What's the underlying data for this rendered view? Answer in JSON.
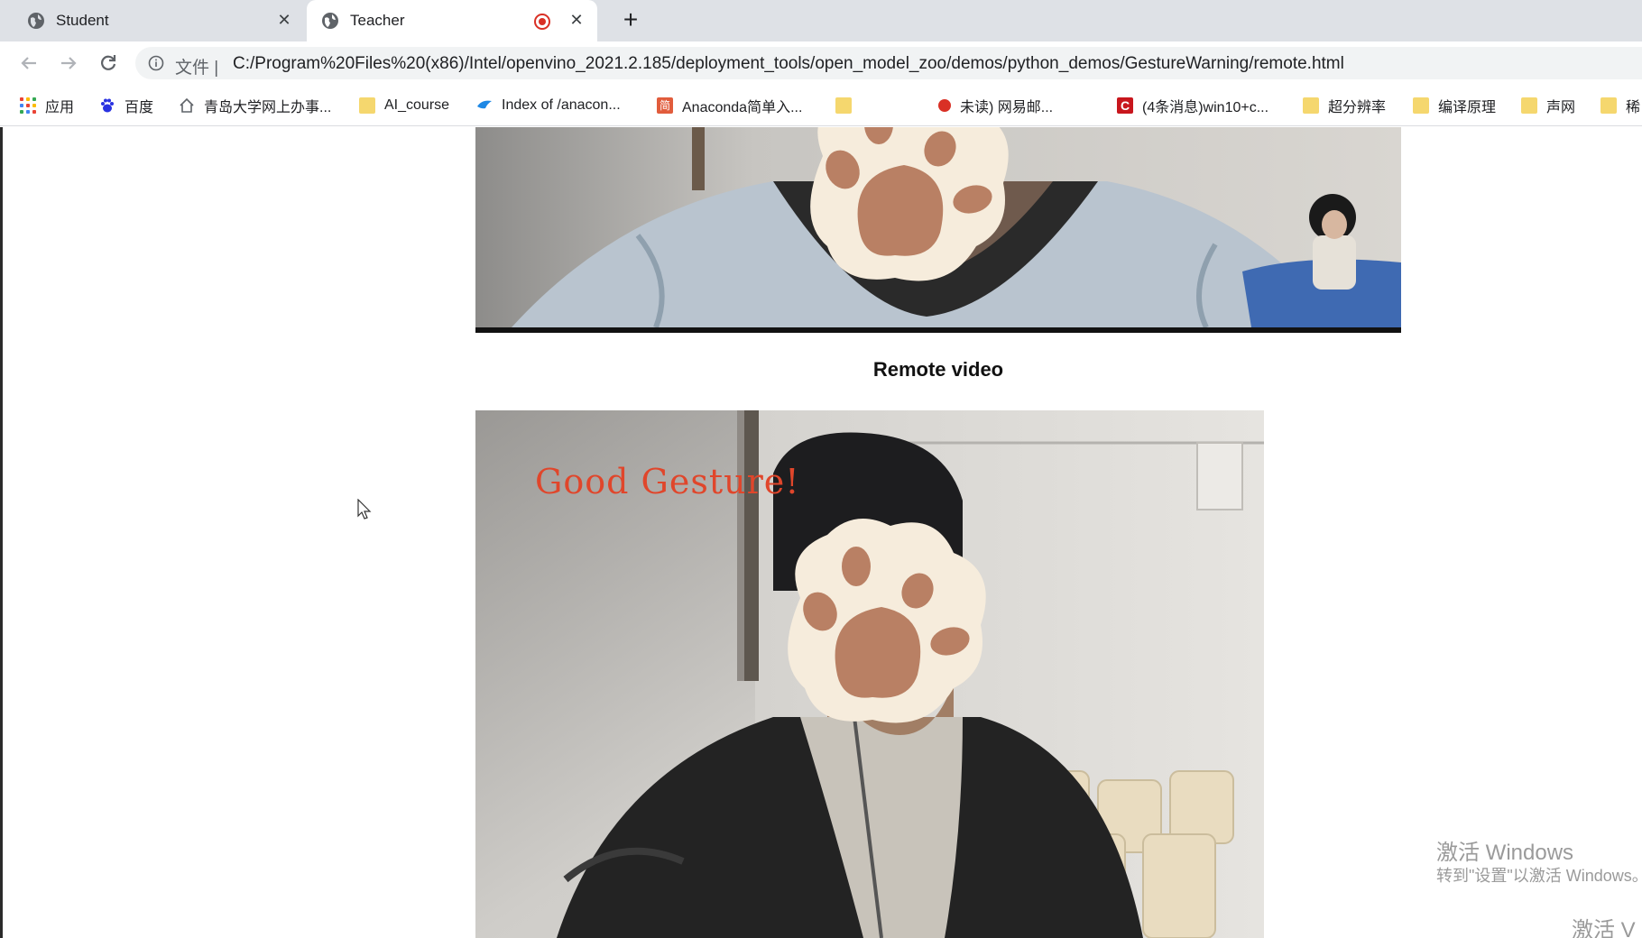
{
  "tabs": [
    {
      "title": "Student",
      "active": false
    },
    {
      "title": "Teacher",
      "active": true,
      "recording": true
    }
  ],
  "address_bar": {
    "scheme_label": "文件 |",
    "url": "C:/Program%20Files%20(x86)/Intel/openvino_2021.2.185/deployment_tools/open_model_zoo/demos/python_demos/GestureWarning/remote.html"
  },
  "bookmarks": [
    {
      "label": "应用",
      "icon": "apps-icon"
    },
    {
      "label": "百度",
      "icon": "baidu-paw-icon"
    },
    {
      "label": "青岛大学网上办事...",
      "icon": "house-icon"
    },
    {
      "label": "AI_course",
      "icon": "folder-icon"
    },
    {
      "label": "Index of /anacon...",
      "icon": "bird-icon"
    },
    {
      "label": "Anaconda简单入...",
      "icon": "jian-icon"
    },
    {
      "label": "",
      "icon": "folder-icon"
    },
    {
      "label": "未读) 网易邮...",
      "icon": "mail-icon"
    },
    {
      "label": "(4条消息)win10+c...",
      "icon": "csdn-icon"
    },
    {
      "label": "超分辨率",
      "icon": "folder-icon"
    },
    {
      "label": "编译原理",
      "icon": "folder-icon"
    },
    {
      "label": "声网",
      "icon": "folder-icon"
    },
    {
      "label": "稀",
      "icon": "folder-icon"
    }
  ],
  "page": {
    "remote_title": "Remote video",
    "overlay_text": "Good Gesture!"
  },
  "watermark": {
    "line1": "激活 Windows",
    "line2": "转到\"设置\"以激活 Windows。",
    "line3": "激活 V"
  },
  "colors": {
    "tabstrip": "#dee1e6",
    "overlay_text": "#e0462b",
    "paw_cream": "#f6ecdc",
    "paw_pad": "#b98064"
  }
}
